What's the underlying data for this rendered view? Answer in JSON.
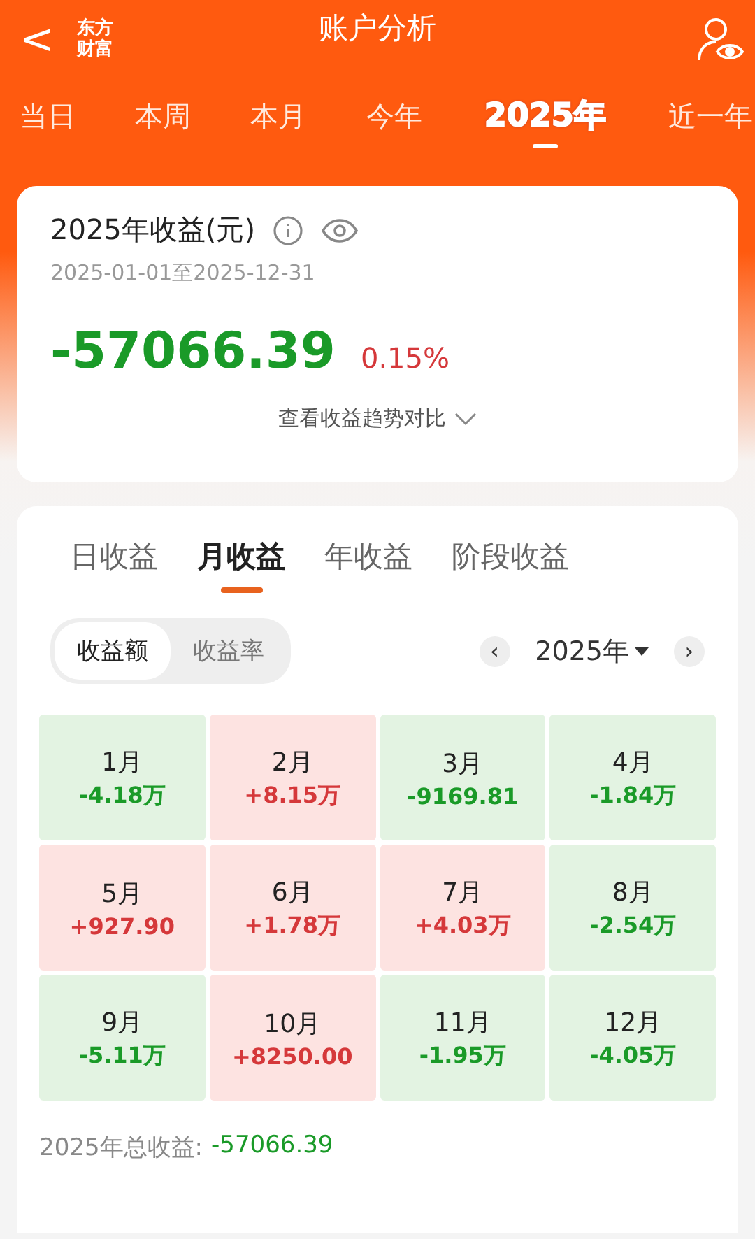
{
  "header": {
    "back": "<",
    "logo": [
      "东方",
      "财富"
    ],
    "title": "账户分析"
  },
  "period_tabs": [
    {
      "label": "当日",
      "selected": false
    },
    {
      "label": "本周",
      "selected": false
    },
    {
      "label": "本月",
      "selected": false
    },
    {
      "label": "今年",
      "selected": false
    },
    {
      "label": "2025年",
      "selected": true
    },
    {
      "label": "近一年",
      "selected": false
    }
  ],
  "summary": {
    "title": "2025年收益(元)",
    "date_range": "2025-01-01至2025-12-31",
    "amount": "-57066.39",
    "rate": "0.15%",
    "trend_link": "查看收益趋势对比"
  },
  "income_tabs": [
    {
      "label": "日收益",
      "selected": false
    },
    {
      "label": "月收益",
      "selected": true
    },
    {
      "label": "年收益",
      "selected": false
    },
    {
      "label": "阶段收益",
      "selected": false
    }
  ],
  "toggle": [
    {
      "label": "收益额",
      "selected": true
    },
    {
      "label": "收益率",
      "selected": false
    }
  ],
  "year_picker": {
    "prev": "‹",
    "value": "2025年",
    "next": "›"
  },
  "months": [
    {
      "month": "1月",
      "value": "-4.18万",
      "kind": "loss"
    },
    {
      "month": "2月",
      "value": "+8.15万",
      "kind": "gain"
    },
    {
      "month": "3月",
      "value": "-9169.81",
      "kind": "loss"
    },
    {
      "month": "4月",
      "value": "-1.84万",
      "kind": "loss"
    },
    {
      "month": "5月",
      "value": "+927.90",
      "kind": "gain"
    },
    {
      "month": "6月",
      "value": "+1.78万",
      "kind": "gain"
    },
    {
      "month": "7月",
      "value": "+4.03万",
      "kind": "gain"
    },
    {
      "month": "8月",
      "value": "-2.54万",
      "kind": "loss"
    },
    {
      "month": "9月",
      "value": "-5.11万",
      "kind": "loss"
    },
    {
      "month": "10月",
      "value": "+8250.00",
      "kind": "gain"
    },
    {
      "month": "11月",
      "value": "-1.95万",
      "kind": "loss"
    },
    {
      "month": "12月",
      "value": "-4.05万",
      "kind": "loss"
    }
  ],
  "total": {
    "label": "2025年总收益:",
    "value": "-57066.39"
  }
}
